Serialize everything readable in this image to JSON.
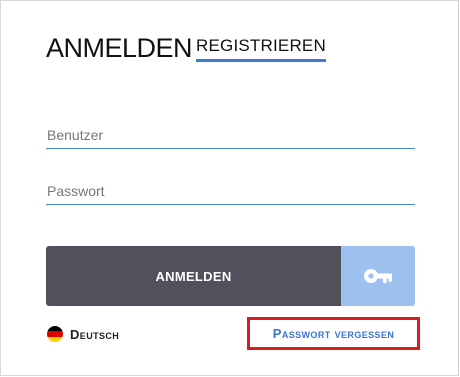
{
  "tabs": {
    "login": "ANMELDEN",
    "register": "REGISTRIEREN"
  },
  "form": {
    "username_placeholder": "Benutzer",
    "password_placeholder": "Passwort",
    "username_value": "",
    "password_value": "",
    "submit_label": "ANMELDEN",
    "key_icon": "key-icon"
  },
  "footer": {
    "language_label": "Deutsch",
    "language_flag": "germany-flag-icon",
    "forgot_password_label": "Passwort vergessen"
  },
  "colors": {
    "submit_bg": "#52505c",
    "key_bg": "#9cc1ef",
    "accent": "#3d7bd4",
    "highlight_border": "#d91e1e"
  }
}
